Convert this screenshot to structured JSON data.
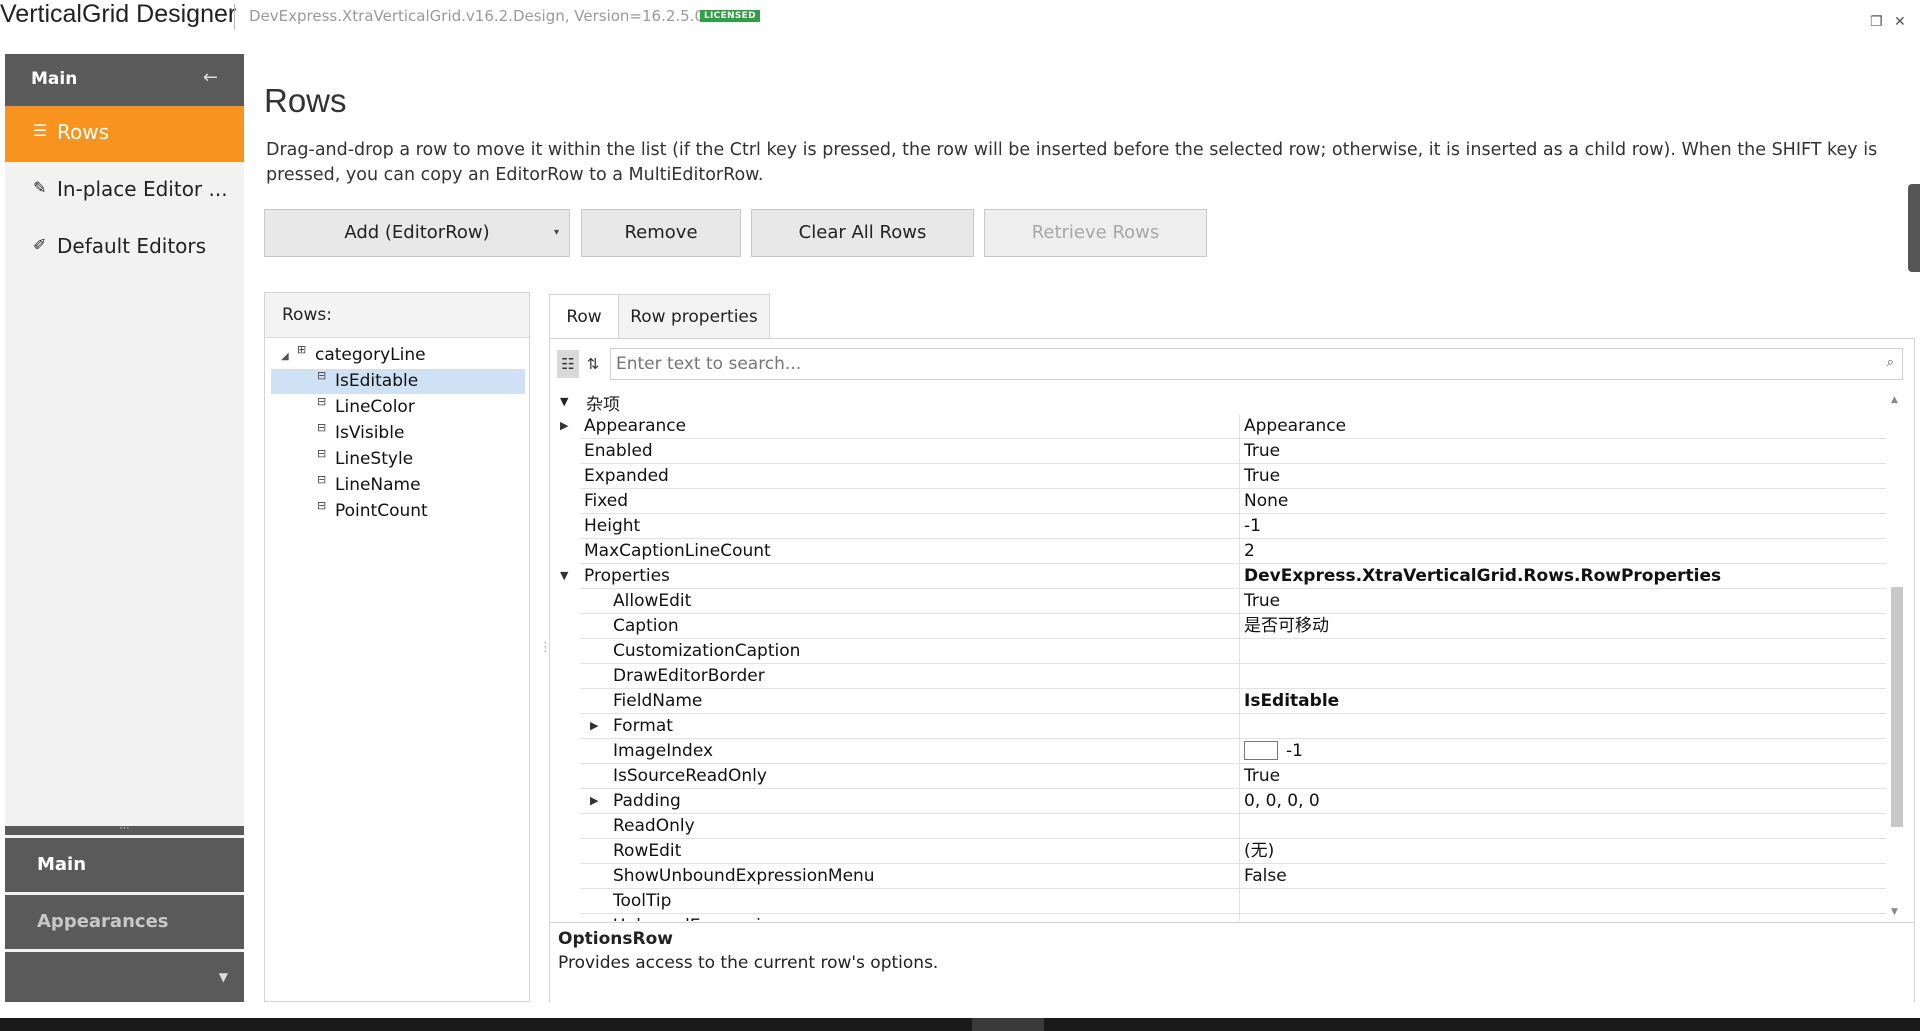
{
  "window": {
    "title": "VerticalGrid Designer",
    "version": "DevExpress.XtraVerticalGrid.v16.2.Design, Version=16.2.5.0",
    "badge": "LICENSED",
    "restore_icon": "restore-icon",
    "close_icon": "close-icon"
  },
  "nav": {
    "header": "Main",
    "items": [
      {
        "label": "Rows",
        "icon": "list-icon",
        "active": true
      },
      {
        "label": "In-place Editor ...",
        "icon": "edit-icon",
        "active": false
      },
      {
        "label": "Default Editors",
        "icon": "pencil-icon",
        "active": false
      }
    ],
    "groups": [
      {
        "label": "Main"
      },
      {
        "label": "Appearances"
      }
    ],
    "accent_color": "#f7931e"
  },
  "page": {
    "title": "Rows",
    "description": "Drag-and-drop a row to move it within the list (if the Ctrl key is pressed, the row will be inserted before the selected row; otherwise, it is inserted as a child row). When the SHIFT key is pressed, you can copy an EditorRow to a MultiEditorRow."
  },
  "toolbar": {
    "add": "Add (EditorRow)",
    "remove": "Remove",
    "clear": "Clear All Rows",
    "retrieve": "Retrieve Rows"
  },
  "rows_panel": {
    "header": "Rows:",
    "root": "categoryLine",
    "children": [
      "IsEditable",
      "LineColor",
      "IsVisible",
      "LineStyle",
      "LineName",
      "PointCount"
    ],
    "selected": "IsEditable"
  },
  "tabs": [
    {
      "label": "Row",
      "active": true
    },
    {
      "label": "Row properties",
      "active": false
    }
  ],
  "search": {
    "placeholder": "Enter text to search..."
  },
  "property_grid": {
    "category": "杂项",
    "rows": [
      {
        "name": "Appearance",
        "value": "Appearance",
        "expandable": true
      },
      {
        "name": "Enabled",
        "value": "True"
      },
      {
        "name": "Expanded",
        "value": "True"
      },
      {
        "name": "Fixed",
        "value": "None"
      },
      {
        "name": "Height",
        "value": "-1"
      },
      {
        "name": "MaxCaptionLineCount",
        "value": "2"
      },
      {
        "name": "Properties",
        "value": "DevExpress.XtraVerticalGrid.Rows.RowProperties",
        "expanded": true,
        "bold": true
      },
      {
        "name": "AllowEdit",
        "value": "True",
        "sub": true
      },
      {
        "name": "Caption",
        "value": "是否可移动",
        "sub": true
      },
      {
        "name": "CustomizationCaption",
        "value": "",
        "sub": true
      },
      {
        "name": "DrawEditorBorder",
        "value": "",
        "sub": true
      },
      {
        "name": "FieldName",
        "value": "IsEditable",
        "sub": true,
        "bold": true
      },
      {
        "name": "Format",
        "value": "",
        "sub": true,
        "expandable": true
      },
      {
        "name": "ImageIndex",
        "value": "-1",
        "sub": true,
        "swatch": true
      },
      {
        "name": "IsSourceReadOnly",
        "value": "True",
        "sub": true
      },
      {
        "name": "Padding",
        "value": "0, 0, 0, 0",
        "sub": true,
        "expandable": true
      },
      {
        "name": "ReadOnly",
        "value": "",
        "sub": true
      },
      {
        "name": "RowEdit",
        "value": "(无)",
        "sub": true
      },
      {
        "name": "ShowUnboundExpressionMenu",
        "value": "False",
        "sub": true
      },
      {
        "name": "ToolTip",
        "value": "",
        "sub": true
      },
      {
        "name": "UnboundExpression",
        "value": "",
        "sub": true
      }
    ]
  },
  "description_panel": {
    "title": "OptionsRow",
    "text": "Provides access to the current row's options."
  }
}
